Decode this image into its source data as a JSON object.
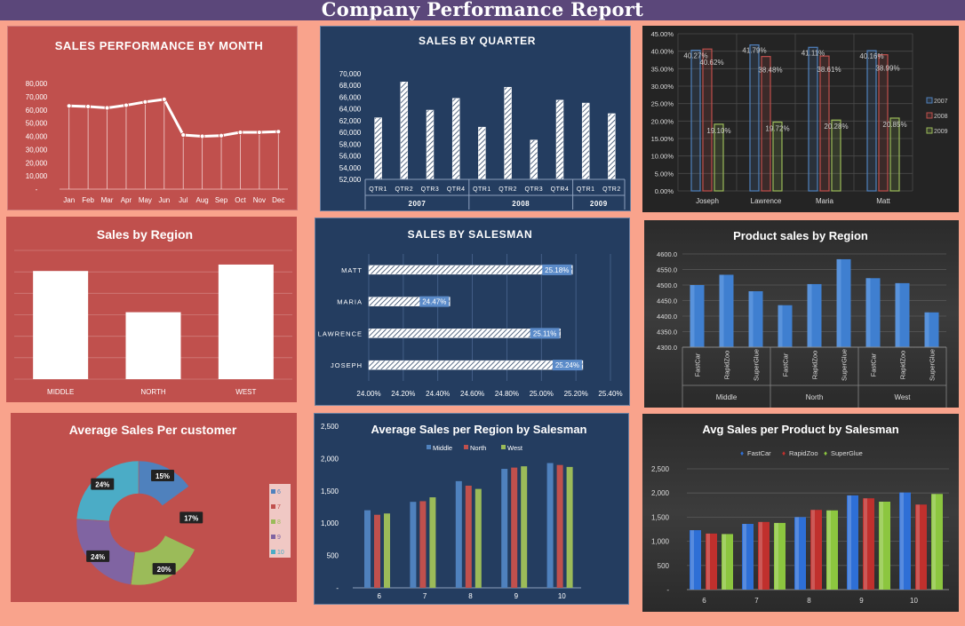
{
  "page": {
    "title": "Company Performance Report"
  },
  "chart_data": [
    {
      "id": "monthly",
      "type": "line",
      "title": "SALES PERFORMANCE BY MONTH",
      "categories": [
        "Jan",
        "Feb",
        "Mar",
        "Apr",
        "May",
        "Jun",
        "Jul",
        "Aug",
        "Sep",
        "Oct",
        "Nov",
        "Dec"
      ],
      "values": [
        63000,
        62500,
        61500,
        63500,
        66000,
        68000,
        41000,
        40000,
        40500,
        43000,
        43000,
        43500
      ],
      "yticks": [
        "80,000",
        "70,000",
        "60,000",
        "50,000",
        "40,000",
        "30,000",
        "20,000",
        "10,000",
        "-"
      ],
      "ylim": [
        0,
        80000
      ],
      "grid": false,
      "colors": {
        "background": "#c0504d",
        "line": "#ffffff"
      }
    },
    {
      "id": "quarter",
      "type": "bar",
      "title": "SALES BY QUARTER",
      "categories": [
        "QTR1",
        "QTR2",
        "QTR3",
        "QTR4",
        "QTR1",
        "QTR2",
        "QTR3",
        "QTR4",
        "QTR1",
        "QTR2"
      ],
      "groups": [
        {
          "label": "2007",
          "count": 4
        },
        {
          "label": "2008",
          "count": 4
        },
        {
          "label": "2009",
          "count": 2
        }
      ],
      "values": [
        62500,
        68600,
        63800,
        65800,
        60900,
        67700,
        58700,
        65500,
        65000,
        63200
      ],
      "yticks": [
        "70,000",
        "68,000",
        "66,000",
        "64,000",
        "62,000",
        "60,000",
        "58,000",
        "56,000",
        "54,000",
        "52,000"
      ],
      "ylim": [
        52000,
        70000
      ],
      "colors": {
        "background": "#243d60",
        "bar": "#ffffff"
      }
    },
    {
      "id": "salesman_pct",
      "type": "bar",
      "categories": [
        "Joseph",
        "Lawrence",
        "Maria",
        "Matt"
      ],
      "series": [
        {
          "name": "2007",
          "values": [
            40.27,
            41.79,
            41.11,
            40.16
          ],
          "labels": [
            "40.27%",
            "41.79%",
            "41.11%",
            "40.16%"
          ],
          "color": "#4f81bd"
        },
        {
          "name": "2008",
          "values": [
            40.62,
            38.48,
            38.61,
            38.99
          ],
          "labels": [
            "40.62%",
            "38.48%",
            "38.61%",
            "38.99%"
          ],
          "color": "#c0504d"
        },
        {
          "name": "2009",
          "values": [
            19.1,
            19.72,
            20.28,
            20.85
          ],
          "labels": [
            "19.10%",
            "19.72%",
            "20.28%",
            "20.85%"
          ],
          "color": "#9bbb59"
        }
      ],
      "yticks": [
        "45.00%",
        "40.00%",
        "35.00%",
        "30.00%",
        "25.00%",
        "20.00%",
        "15.00%",
        "10.00%",
        "5.00%",
        "0.00%"
      ],
      "ylim": [
        0,
        45
      ],
      "grid": true,
      "legend": "right"
    },
    {
      "id": "region",
      "type": "bar",
      "title": "Sales by Region",
      "categories": [
        "MIDDLE",
        "NORTH",
        "WEST"
      ],
      "values": [
        0.84,
        0.52,
        0.89
      ],
      "grid": true,
      "colors": {
        "background": "#c0504d",
        "bar": "#ffffff"
      }
    },
    {
      "id": "salesman_bar",
      "type": "bar",
      "orientation": "horizontal",
      "title": "SALES BY SALESMAN",
      "categories": [
        "MATT",
        "MARIA",
        "LAWRENCE",
        "JOSEPH"
      ],
      "values": [
        25.18,
        24.47,
        25.11,
        25.24
      ],
      "labels": [
        "25.18%",
        "24.47%",
        "25.11%",
        "25.24%"
      ],
      "xticks": [
        "24.00%",
        "24.20%",
        "24.40%",
        "24.60%",
        "24.80%",
        "25.00%",
        "25.20%",
        "25.40%"
      ],
      "xlim": [
        24.0,
        25.4
      ],
      "colors": {
        "background": "#243d60",
        "label_bg": "#5b8bc9"
      }
    },
    {
      "id": "product_region",
      "type": "bar",
      "title": "Product sales by Region",
      "categories": [
        "FastCar",
        "RapidZoo",
        "SuperGlue",
        "FastCar",
        "RapidZoo",
        "SuperGlue",
        "FastCar",
        "RapidZoo",
        "SuperGlue"
      ],
      "groups": [
        {
          "label": "Middle",
          "count": 3
        },
        {
          "label": "North",
          "count": 3
        },
        {
          "label": "West",
          "count": 3
        }
      ],
      "values": [
        4500,
        4533,
        4480,
        4435,
        4503,
        4583,
        4522,
        4506,
        4412
      ],
      "yticks": [
        "4600.0",
        "4550.0",
        "4500.0",
        "4450.0",
        "4400.0",
        "4350.0",
        "4300.0"
      ],
      "ylim": [
        4300,
        4600
      ],
      "grid": true,
      "colors": {
        "bar": "#3f7fd0"
      }
    },
    {
      "id": "avg_customer",
      "type": "pie",
      "title": "Average Sales Per customer",
      "categories": [
        "6",
        "7",
        "8",
        "9",
        "10"
      ],
      "values": [
        15,
        17,
        20,
        24,
        24
      ],
      "labels": [
        "15%",
        "17%",
        "20%",
        "24%",
        "24%"
      ],
      "colors": [
        "#4f81bd",
        "#c0504d",
        "#9bbb59",
        "#8064a2",
        "#4bacc6"
      ],
      "legend": "right"
    },
    {
      "id": "avg_region_salesman",
      "type": "bar",
      "title": "Average Sales per Region by Salesman",
      "categories": [
        "6",
        "7",
        "8",
        "9",
        "10"
      ],
      "series": [
        {
          "name": "Middle",
          "values": [
            1200,
            1330,
            1650,
            1840,
            1930
          ],
          "color": "#4f81bd"
        },
        {
          "name": "North",
          "values": [
            1130,
            1340,
            1580,
            1860,
            1900
          ],
          "color": "#c0504d"
        },
        {
          "name": "West",
          "values": [
            1150,
            1400,
            1530,
            1880,
            1870
          ],
          "color": "#9bbb59"
        }
      ],
      "yticks": [
        "2,500",
        "2,000",
        "1,500",
        "1,000",
        "500",
        "-"
      ],
      "ylim": [
        0,
        2500
      ],
      "legend": "top"
    },
    {
      "id": "avg_product_salesman",
      "type": "bar",
      "title": "Avg Sales per Product by Salesman",
      "categories": [
        "6",
        "7",
        "8",
        "9",
        "10"
      ],
      "series": [
        {
          "name": "FastCar",
          "values": [
            1230,
            1360,
            1500,
            1950,
            2010
          ],
          "color": "#2e6fd6"
        },
        {
          "name": "RapidZoo",
          "values": [
            1160,
            1400,
            1650,
            1890,
            1760
          ],
          "color": "#c0302d"
        },
        {
          "name": "SuperGlue",
          "values": [
            1150,
            1380,
            1640,
            1820,
            1980
          ],
          "color": "#8cc63f"
        }
      ],
      "yticks": [
        "2,500",
        "2,000",
        "1,500",
        "1,000",
        "500",
        "-"
      ],
      "ylim": [
        0,
        2500
      ],
      "grid": true,
      "legend": "top"
    }
  ]
}
